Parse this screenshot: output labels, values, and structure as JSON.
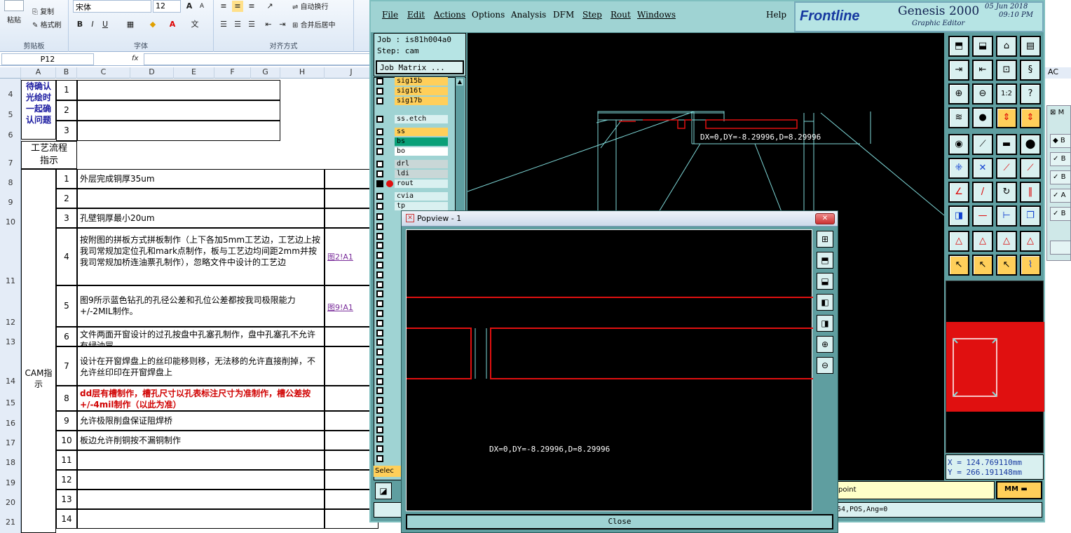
{
  "excel": {
    "ribbon": {
      "paste": "粘贴",
      "copy": "复制",
      "format_painter": "格式刷",
      "font_name": "宋体",
      "font_size": "12",
      "wrap_text": "自动换行",
      "merge_center": "合并后居中",
      "groups": {
        "clipboard": "剪贴板",
        "font": "字体",
        "alignment": "对齐方式"
      }
    },
    "formula_bar": {
      "name_box": "P12",
      "fx": "fx"
    },
    "columns": [
      "A",
      "B",
      "C",
      "D",
      "E",
      "F",
      "G",
      "H",
      "J"
    ],
    "far_column": "AC",
    "rows": [
      "4",
      "5",
      "6",
      "7",
      "8",
      "9",
      "10",
      "11",
      "12",
      "13",
      "14",
      "15",
      "16",
      "17",
      "18",
      "19",
      "20",
      "21"
    ],
    "pending_label": "待确认光绘时一起确认问题",
    "process_label": "工艺流程指示",
    "cam_label": "CAM指示",
    "pending_nums": [
      "1",
      "2",
      "3"
    ],
    "items": [
      {
        "no": "1",
        "text": "外层完成铜厚35um",
        "ref": ""
      },
      {
        "no": "2",
        "text": "",
        "ref": ""
      },
      {
        "no": "3",
        "text": "孔壁铜厚最小20um",
        "ref": ""
      },
      {
        "no": "4",
        "text": "按附图的拼板方式拼板制作（上下各加5mm工艺边，工艺边上按我司常规加定位孔和mark点制作，板与工艺边均间距2mm并按我司常规加桥连油票孔制作），忽略文件中设计的工艺边",
        "ref": "图2!A1"
      },
      {
        "no": "5",
        "text": "图9所示蓝色钻孔的孔径公差和孔位公差都按我司极限能力+/-2MIL制作。",
        "ref": "图9!A1"
      },
      {
        "no": "6",
        "text": "文件两面开窗设计的过孔按盘中孔塞孔制作，盘中孔塞孔不允许有绿油冒",
        "ref": ""
      },
      {
        "no": "7",
        "text": "设计在开窗焊盘上的丝印能移则移，无法移的允许直接削掉，不允许丝印印在开窗焊盘上",
        "ref": ""
      },
      {
        "no": "8",
        "text": "dd层有槽制作，槽孔尺寸以孔表标注尺寸为准制作，槽公差按+/-4mil制作（以此为准）",
        "ref": ""
      },
      {
        "no": "9",
        "text": "允许极限削盘保证阻焊桥",
        "ref": ""
      },
      {
        "no": "10",
        "text": "板边允许削铜按不漏铜制作",
        "ref": ""
      },
      {
        "no": "11",
        "text": "",
        "ref": ""
      },
      {
        "no": "12",
        "text": "",
        "ref": ""
      },
      {
        "no": "13",
        "text": "",
        "ref": ""
      },
      {
        "no": "14",
        "text": "",
        "ref": ""
      }
    ]
  },
  "genesis": {
    "menu": [
      "File",
      "Edit",
      "Actions",
      "Options",
      "Analysis",
      "DFM",
      "Step",
      "Rout",
      "Windows"
    ],
    "help": "Help",
    "brand": "Frontline",
    "product": "Genesis 2000",
    "subtitle": "Graphic Editor",
    "date": "05 Jun 2018",
    "time": "09:10 PM",
    "job": "Job : is81h004a0",
    "step": "Step: cam",
    "job_matrix": "Job Matrix ...",
    "layers": [
      "sig15b",
      "sig16t",
      "sig17b",
      "ss.etch",
      "ss",
      "bs",
      "bo",
      "drl",
      "ldi",
      "rout",
      "cvia",
      "tp"
    ],
    "measure": "DX=0,DY=-8.29996,D=8.29996",
    "coord_x": "X = 124.769110mm",
    "coord_y": "Y = 266.191148mm",
    "units": "MM",
    "status_hint": "point",
    "status_line": "54,POS,Ang=0",
    "select_label": "Selec",
    "colors": {
      "bg": "#5f9ea0",
      "panel": "#9fd3d3",
      "orange": "#ffcf5a",
      "green": "#0aa078",
      "canvas": "#000000",
      "red": "#e01010",
      "cyan": "#7fd9d9"
    }
  },
  "popview": {
    "title": "Popview - 1",
    "measure": "DX=0,DY=-8.29996,D=8.29996",
    "close": "Close"
  },
  "mini_panel": {
    "title": "M",
    "items": [
      "B",
      "B",
      "B",
      "A",
      "B"
    ]
  }
}
